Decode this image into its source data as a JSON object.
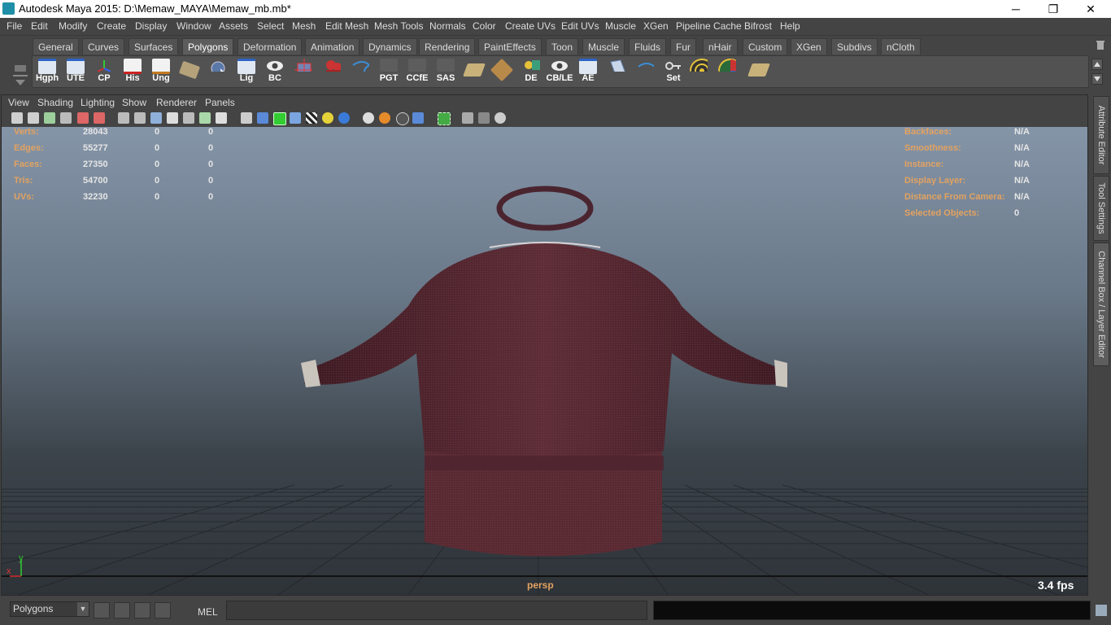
{
  "window": {
    "title": "Autodesk Maya 2015: D:\\Memaw_MAYA\\Memaw_mb.mb*",
    "minimize": "─",
    "restore": "❐",
    "close": "✕"
  },
  "menubar": [
    "File",
    "Edit",
    "Modify",
    "Create",
    "Display",
    "Window",
    "Assets",
    "Select",
    "Mesh",
    "Edit Mesh",
    "Mesh Tools",
    "Normals",
    "Color",
    "Create UVs",
    "Edit UVs",
    "Muscle",
    "XGen",
    "Pipeline Cache",
    "Bifrost",
    "Help"
  ],
  "shelf": {
    "tabs": [
      "General",
      "Curves",
      "Surfaces",
      "Polygons",
      "Deformation",
      "Animation",
      "Dynamics",
      "Rendering",
      "PaintEffects",
      "Toon",
      "Muscle",
      "Fluids",
      "Fur",
      "nHair",
      "Custom",
      "XGen",
      "Subdivs",
      "nCloth"
    ],
    "active_tab": "Polygons",
    "buttons": [
      {
        "label": "Hgph",
        "icon": "hypergraph-icon"
      },
      {
        "label": "UTE",
        "icon": "uv-texture-editor-icon"
      },
      {
        "label": "CP",
        "icon": "center-pivot-icon"
      },
      {
        "label": "His",
        "icon": "history-icon"
      },
      {
        "label": "Ung",
        "icon": "ungroup-icon"
      },
      {
        "label": "",
        "icon": "soap-icon"
      },
      {
        "label": "",
        "icon": "globe-cursor-icon"
      },
      {
        "label": "Lig",
        "icon": "lights-icon"
      },
      {
        "label": "BC",
        "icon": "eye-icon"
      },
      {
        "label": "",
        "icon": "cube-icon"
      },
      {
        "label": "",
        "icon": "render-camera-icon"
      },
      {
        "label": "",
        "icon": "curve-tool-icon"
      },
      {
        "label": "PGT",
        "icon": ""
      },
      {
        "label": "CCfE",
        "icon": ""
      },
      {
        "label": "SAS",
        "icon": ""
      },
      {
        "label": "",
        "icon": "layout-uv-icon"
      },
      {
        "label": "",
        "icon": "uv-tiles-icon"
      },
      {
        "label": "DE",
        "icon": "display-edges-icon"
      },
      {
        "label": "CB/LE",
        "icon": "channel-box-icon"
      },
      {
        "label": "AE",
        "icon": "attribute-editor-icon"
      },
      {
        "label": "",
        "icon": "bevel-icon"
      },
      {
        "label": "",
        "icon": "bridge-icon"
      },
      {
        "label": "Set",
        "icon": "set-key-icon"
      },
      {
        "label": "",
        "icon": "target-icon"
      },
      {
        "label": "",
        "icon": "color-wheel-icon"
      },
      {
        "label": "",
        "icon": "uv-layout-icon"
      }
    ]
  },
  "panel": {
    "menus": [
      "View",
      "Shading",
      "Lighting",
      "Show",
      "Renderer",
      "Panels"
    ],
    "camera": "persp",
    "fps": "3.4 fps",
    "axis": {
      "x": "x",
      "y": "y"
    }
  },
  "hud_left": [
    {
      "label": "Verts:",
      "a": "28043",
      "b": "0",
      "c": "0"
    },
    {
      "label": "Edges:",
      "a": "55277",
      "b": "0",
      "c": "0"
    },
    {
      "label": "Faces:",
      "a": "27350",
      "b": "0",
      "c": "0"
    },
    {
      "label": "Tris:",
      "a": "54700",
      "b": "0",
      "c": "0"
    },
    {
      "label": "UVs:",
      "a": "32230",
      "b": "0",
      "c": "0"
    }
  ],
  "hud_right": [
    {
      "label": "Backfaces:",
      "value": "N/A"
    },
    {
      "label": "Smoothness:",
      "value": "N/A"
    },
    {
      "label": "Instance:",
      "value": "N/A"
    },
    {
      "label": "Display Layer:",
      "value": "N/A"
    },
    {
      "label": "Distance From Camera:",
      "value": "N/A"
    },
    {
      "label": "Selected Objects:",
      "value": "0"
    }
  ],
  "side_tabs": [
    "Attribute Editor",
    "Tool Settings",
    "Channel Box / Layer Editor"
  ],
  "status": {
    "mode": "Polygons",
    "mel_label": "MEL",
    "command": ""
  },
  "colors": {
    "hud_label": "#e3a260",
    "sweater": "#5a2a33",
    "cuff": "#c9c4bc"
  }
}
